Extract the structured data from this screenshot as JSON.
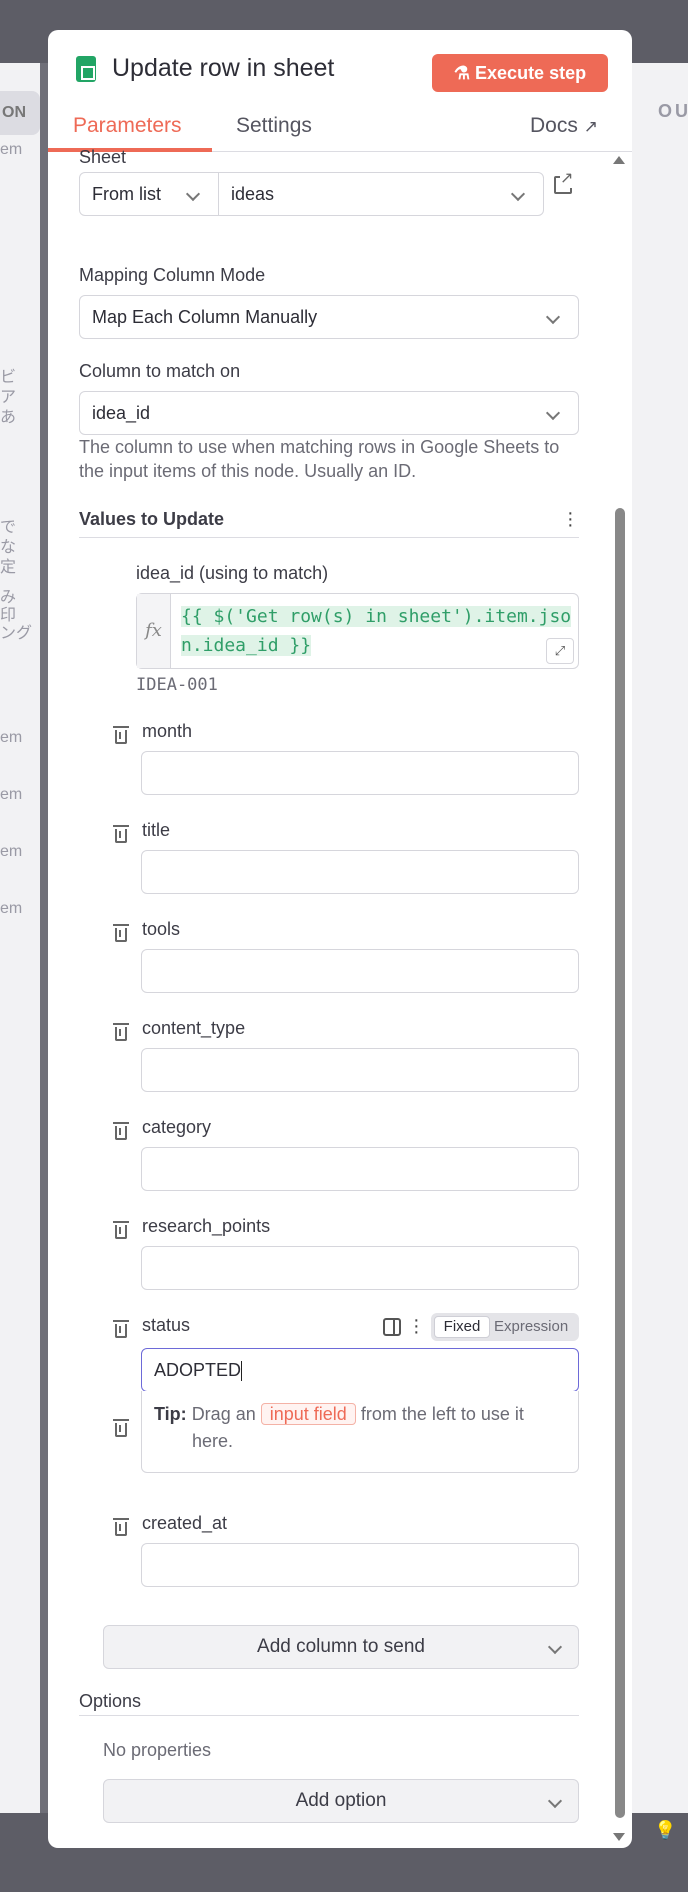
{
  "background": {
    "left_tag": "ON",
    "left_fragments": [
      "em",
      "ビ",
      "ア",
      "あ",
      "で",
      "な",
      "定",
      "み",
      "印",
      "ング",
      "em",
      "em",
      "em",
      "em"
    ],
    "right_label": "OU"
  },
  "panel": {
    "title": "Update row in sheet",
    "execute_label": "Execute step",
    "tabs": [
      {
        "label": "Parameters",
        "active": true
      },
      {
        "label": "Settings",
        "active": false
      }
    ],
    "docs_label": "Docs",
    "accent_color": "#ee6a56"
  },
  "sheet": {
    "label": "Sheet",
    "mode": "From list",
    "value": "ideas"
  },
  "mapping": {
    "label": "Mapping Column Mode",
    "value": "Map Each Column Manually"
  },
  "match": {
    "label": "Column to match on",
    "value": "idea_id",
    "hint": "The column to use when matching rows in Google Sheets to the input items of this node. Usually an ID."
  },
  "values": {
    "title": "Values to Update",
    "match_field": {
      "label": "idea_id (using to match)",
      "expression": "{{ $('Get row(s) in sheet').item.json.idea_id }}",
      "preview": "IDEA-001"
    },
    "fields": [
      {
        "label": "month",
        "value": ""
      },
      {
        "label": "title",
        "value": ""
      },
      {
        "label": "tools",
        "value": ""
      },
      {
        "label": "content_type",
        "value": ""
      },
      {
        "label": "category",
        "value": ""
      },
      {
        "label": "research_points",
        "value": ""
      }
    ],
    "status": {
      "label": "status",
      "value": "ADOPTED",
      "mode_fixed": "Fixed",
      "mode_expression": "Expression"
    },
    "tip": {
      "prefix": "Tip:",
      "text_before": "Drag an",
      "chip": "input field",
      "text_after": "from the left to use it",
      "text_end": "here."
    },
    "last_field": {
      "label": "created_at",
      "value": ""
    },
    "add_column_label": "Add column to send"
  },
  "options": {
    "title": "Options",
    "empty_text": "No properties",
    "add_option_label": "Add option"
  }
}
